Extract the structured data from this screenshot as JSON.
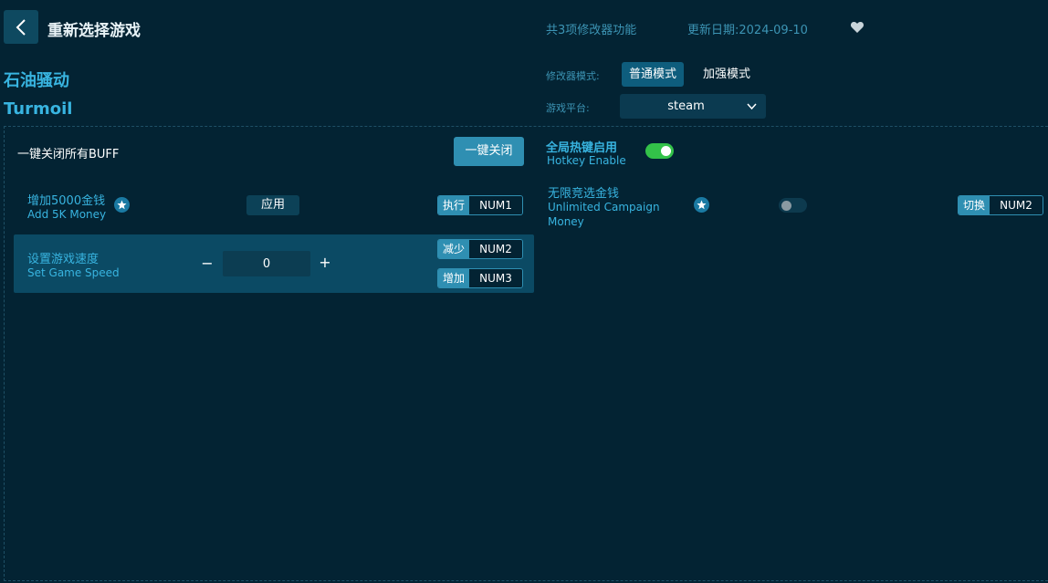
{
  "header": {
    "back_icon": "chevron-left-icon",
    "title": "重新选择游戏",
    "feature_count": "共3项修改器功能",
    "update_date": "更新日期:2024-09-10",
    "favorite_icon": "heart-icon"
  },
  "game": {
    "name_cn": "石油骚动",
    "name_en": "Turmoil"
  },
  "mode": {
    "label": "修改器模式:",
    "options": [
      "普通模式",
      "加强模式"
    ],
    "selected": "普通模式"
  },
  "platform": {
    "label": "游戏平台:",
    "value": "steam"
  },
  "close_all": {
    "label": "一键关闭所有BUFF",
    "button": "一键关闭"
  },
  "hotkey": {
    "label": "全局热键启用",
    "sub": "Hotkey Enable",
    "enabled": true
  },
  "options": [
    {
      "name_cn": "增加5000金钱",
      "name_en": "Add 5K Money",
      "button": "应用",
      "keys": [
        {
          "tag": "执行",
          "key": "NUM1"
        }
      ]
    },
    {
      "name_cn": "设置游戏速度",
      "name_en": "Set Game Speed",
      "value": "0",
      "minus": "−",
      "plus": "+",
      "keys": [
        {
          "tag": "减少",
          "key": "NUM2"
        },
        {
          "tag": "增加",
          "key": "NUM3"
        }
      ]
    },
    {
      "name_cn": "无限竞选金钱",
      "name_en_1": "Unlimited Campaign",
      "name_en_2": "Money",
      "enabled": false,
      "keys": [
        {
          "tag": "切换",
          "key": "NUM2"
        }
      ]
    }
  ],
  "colors": {
    "background": "#032333",
    "accent": "#38b4e0",
    "button": "#2f8fb2",
    "toggle_on": "#33c249"
  }
}
